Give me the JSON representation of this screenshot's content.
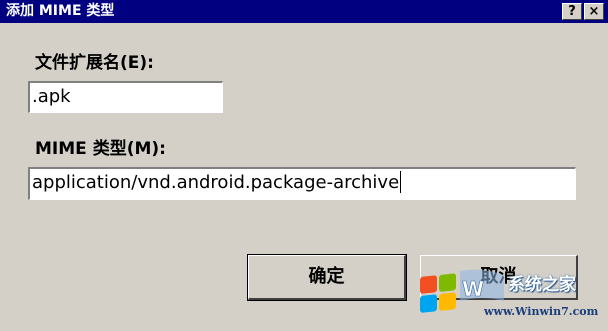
{
  "window": {
    "title": "添加 MIME 类型",
    "help_glyph": "?",
    "close_glyph": "×"
  },
  "form": {
    "extension_label": "文件扩展名(E):",
    "extension_value": ".apk",
    "mime_label": "MIME 类型(M):",
    "mime_value": "application/vnd.android.package-archive"
  },
  "buttons": {
    "ok_label": "确定",
    "cancel_label": "取消"
  },
  "watermark": {
    "site_name": "系统之家",
    "url": "www.Winwin7.com"
  }
}
